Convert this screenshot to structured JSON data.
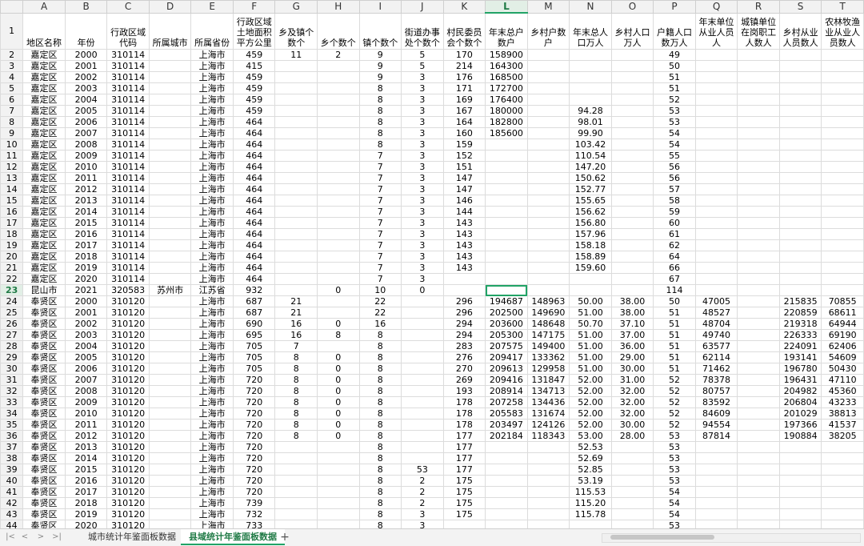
{
  "columns": [
    "A",
    "B",
    "C",
    "D",
    "E",
    "F",
    "G",
    "H",
    "I",
    "J",
    "K",
    "L",
    "M",
    "N",
    "O",
    "P",
    "Q",
    "R",
    "S",
    "T"
  ],
  "selected_column": "L",
  "selected_row": "23",
  "headers": [
    "地区名称",
    "年份",
    "行政区域代码",
    "所属城市",
    "所属省份",
    "行政区域土地面积平方公里",
    "乡及镇个数个",
    "乡个数个",
    "镇个数个",
    "街道办事处个数个",
    "村民委员会个数个",
    "年末总户数户",
    "乡村户数户",
    "年末总人口万人",
    "乡村人口万人",
    "户籍人口数万人",
    "年末单位从业人员人",
    "城镇单位在岗职工人数人",
    "乡村从业人员数人",
    "农林牧渔业从业人员数人"
  ],
  "rows": [
    {
      "n": "2",
      "c": [
        "嘉定区",
        "2000",
        "310114",
        "",
        "上海市",
        "459",
        "11",
        "2",
        "9",
        "5",
        "170",
        "158900",
        "",
        "",
        "",
        "49",
        "",
        "",
        "",
        ""
      ]
    },
    {
      "n": "3",
      "c": [
        "嘉定区",
        "2001",
        "310114",
        "",
        "上海市",
        "415",
        "",
        "",
        "9",
        "5",
        "214",
        "164300",
        "",
        "",
        "",
        "50",
        "",
        "",
        "",
        ""
      ]
    },
    {
      "n": "4",
      "c": [
        "嘉定区",
        "2002",
        "310114",
        "",
        "上海市",
        "459",
        "",
        "",
        "9",
        "3",
        "176",
        "168500",
        "",
        "",
        "",
        "51",
        "",
        "",
        "",
        ""
      ]
    },
    {
      "n": "5",
      "c": [
        "嘉定区",
        "2003",
        "310114",
        "",
        "上海市",
        "459",
        "",
        "",
        "8",
        "3",
        "171",
        "172700",
        "",
        "",
        "",
        "51",
        "",
        "",
        "",
        ""
      ]
    },
    {
      "n": "6",
      "c": [
        "嘉定区",
        "2004",
        "310114",
        "",
        "上海市",
        "459",
        "",
        "",
        "8",
        "3",
        "169",
        "176400",
        "",
        "",
        "",
        "52",
        "",
        "",
        "",
        ""
      ]
    },
    {
      "n": "7",
      "c": [
        "嘉定区",
        "2005",
        "310114",
        "",
        "上海市",
        "459",
        "",
        "",
        "8",
        "3",
        "167",
        "180000",
        "",
        "94.28",
        "",
        "53",
        "",
        "",
        "",
        ""
      ]
    },
    {
      "n": "8",
      "c": [
        "嘉定区",
        "2006",
        "310114",
        "",
        "上海市",
        "464",
        "",
        "",
        "8",
        "3",
        "164",
        "182800",
        "",
        "98.01",
        "",
        "53",
        "",
        "",
        "",
        ""
      ]
    },
    {
      "n": "9",
      "c": [
        "嘉定区",
        "2007",
        "310114",
        "",
        "上海市",
        "464",
        "",
        "",
        "8",
        "3",
        "160",
        "185600",
        "",
        "99.90",
        "",
        "54",
        "",
        "",
        "",
        ""
      ]
    },
    {
      "n": "10",
      "c": [
        "嘉定区",
        "2008",
        "310114",
        "",
        "上海市",
        "464",
        "",
        "",
        "8",
        "3",
        "159",
        "",
        "",
        "103.42",
        "",
        "54",
        "",
        "",
        "",
        ""
      ]
    },
    {
      "n": "11",
      "c": [
        "嘉定区",
        "2009",
        "310114",
        "",
        "上海市",
        "464",
        "",
        "",
        "7",
        "3",
        "152",
        "",
        "",
        "110.54",
        "",
        "55",
        "",
        "",
        "",
        ""
      ]
    },
    {
      "n": "12",
      "c": [
        "嘉定区",
        "2010",
        "310114",
        "",
        "上海市",
        "464",
        "",
        "",
        "7",
        "3",
        "151",
        "",
        "",
        "147.20",
        "",
        "56",
        "",
        "",
        "",
        ""
      ]
    },
    {
      "n": "13",
      "c": [
        "嘉定区",
        "2011",
        "310114",
        "",
        "上海市",
        "464",
        "",
        "",
        "7",
        "3",
        "147",
        "",
        "",
        "150.62",
        "",
        "56",
        "",
        "",
        "",
        ""
      ]
    },
    {
      "n": "14",
      "c": [
        "嘉定区",
        "2012",
        "310114",
        "",
        "上海市",
        "464",
        "",
        "",
        "7",
        "3",
        "147",
        "",
        "",
        "152.77",
        "",
        "57",
        "",
        "",
        "",
        ""
      ]
    },
    {
      "n": "15",
      "c": [
        "嘉定区",
        "2013",
        "310114",
        "",
        "上海市",
        "464",
        "",
        "",
        "7",
        "3",
        "146",
        "",
        "",
        "155.65",
        "",
        "58",
        "",
        "",
        "",
        ""
      ]
    },
    {
      "n": "16",
      "c": [
        "嘉定区",
        "2014",
        "310114",
        "",
        "上海市",
        "464",
        "",
        "",
        "7",
        "3",
        "144",
        "",
        "",
        "156.62",
        "",
        "59",
        "",
        "",
        "",
        ""
      ]
    },
    {
      "n": "17",
      "c": [
        "嘉定区",
        "2015",
        "310114",
        "",
        "上海市",
        "464",
        "",
        "",
        "7",
        "3",
        "143",
        "",
        "",
        "156.80",
        "",
        "60",
        "",
        "",
        "",
        ""
      ]
    },
    {
      "n": "18",
      "c": [
        "嘉定区",
        "2016",
        "310114",
        "",
        "上海市",
        "464",
        "",
        "",
        "7",
        "3",
        "143",
        "",
        "",
        "157.96",
        "",
        "61",
        "",
        "",
        "",
        ""
      ]
    },
    {
      "n": "19",
      "c": [
        "嘉定区",
        "2017",
        "310114",
        "",
        "上海市",
        "464",
        "",
        "",
        "7",
        "3",
        "143",
        "",
        "",
        "158.18",
        "",
        "62",
        "",
        "",
        "",
        ""
      ]
    },
    {
      "n": "20",
      "c": [
        "嘉定区",
        "2018",
        "310114",
        "",
        "上海市",
        "464",
        "",
        "",
        "7",
        "3",
        "143",
        "",
        "",
        "158.89",
        "",
        "64",
        "",
        "",
        "",
        ""
      ]
    },
    {
      "n": "21",
      "c": [
        "嘉定区",
        "2019",
        "310114",
        "",
        "上海市",
        "464",
        "",
        "",
        "7",
        "3",
        "143",
        "",
        "",
        "159.60",
        "",
        "66",
        "",
        "",
        "",
        ""
      ]
    },
    {
      "n": "22",
      "c": [
        "嘉定区",
        "2020",
        "310114",
        "",
        "上海市",
        "464",
        "",
        "",
        "7",
        "3",
        "",
        "",
        "",
        "",
        "",
        "67",
        "",
        "",
        "",
        ""
      ]
    },
    {
      "n": "23",
      "c": [
        "昆山市",
        "2021",
        "320583",
        "苏州市",
        "江苏省",
        "932",
        "",
        "0",
        "10",
        "0",
        "",
        "",
        "",
        "",
        "",
        "114",
        "",
        "",
        "",
        ""
      ]
    },
    {
      "n": "24",
      "c": [
        "奉贤区",
        "2000",
        "310120",
        "",
        "上海市",
        "687",
        "21",
        "",
        "22",
        "",
        "296",
        "194687",
        "148963",
        "50.00",
        "38.00",
        "50",
        "47005",
        "",
        "215835",
        "70855"
      ]
    },
    {
      "n": "25",
      "c": [
        "奉贤区",
        "2001",
        "310120",
        "",
        "上海市",
        "687",
        "21",
        "",
        "22",
        "",
        "296",
        "202500",
        "149690",
        "51.00",
        "38.00",
        "51",
        "48527",
        "",
        "220859",
        "68611"
      ]
    },
    {
      "n": "26",
      "c": [
        "奉贤区",
        "2002",
        "310120",
        "",
        "上海市",
        "690",
        "16",
        "0",
        "16",
        "",
        "294",
        "203600",
        "148648",
        "50.70",
        "37.10",
        "51",
        "48704",
        "",
        "219318",
        "64944"
      ]
    },
    {
      "n": "27",
      "c": [
        "奉贤区",
        "2003",
        "310120",
        "",
        "上海市",
        "695",
        "16",
        "8",
        "8",
        "",
        "294",
        "205300",
        "147175",
        "51.00",
        "37.00",
        "51",
        "49740",
        "",
        "226333",
        "69190"
      ]
    },
    {
      "n": "28",
      "c": [
        "奉贤区",
        "2004",
        "310120",
        "",
        "上海市",
        "705",
        "7",
        "",
        "8",
        "",
        "283",
        "207575",
        "149400",
        "51.00",
        "36.00",
        "51",
        "63577",
        "",
        "224091",
        "62406"
      ]
    },
    {
      "n": "29",
      "c": [
        "奉贤区",
        "2005",
        "310120",
        "",
        "上海市",
        "705",
        "8",
        "0",
        "8",
        "",
        "276",
        "209417",
        "133362",
        "51.00",
        "29.00",
        "51",
        "62114",
        "",
        "193141",
        "54609"
      ]
    },
    {
      "n": "30",
      "c": [
        "奉贤区",
        "2006",
        "310120",
        "",
        "上海市",
        "705",
        "8",
        "0",
        "8",
        "",
        "270",
        "209613",
        "129958",
        "51.00",
        "30.00",
        "51",
        "71462",
        "",
        "196780",
        "50430"
      ]
    },
    {
      "n": "31",
      "c": [
        "奉贤区",
        "2007",
        "310120",
        "",
        "上海市",
        "720",
        "8",
        "0",
        "8",
        "",
        "269",
        "209416",
        "131847",
        "52.00",
        "31.00",
        "52",
        "78378",
        "",
        "196431",
        "47110"
      ]
    },
    {
      "n": "32",
      "c": [
        "奉贤区",
        "2008",
        "310120",
        "",
        "上海市",
        "720",
        "8",
        "0",
        "8",
        "",
        "193",
        "208914",
        "134713",
        "52.00",
        "32.00",
        "52",
        "80757",
        "",
        "204982",
        "45360"
      ]
    },
    {
      "n": "33",
      "c": [
        "奉贤区",
        "2009",
        "310120",
        "",
        "上海市",
        "720",
        "8",
        "0",
        "8",
        "",
        "178",
        "207258",
        "134436",
        "52.00",
        "32.00",
        "52",
        "83592",
        "",
        "206804",
        "43233"
      ]
    },
    {
      "n": "34",
      "c": [
        "奉贤区",
        "2010",
        "310120",
        "",
        "上海市",
        "720",
        "8",
        "0",
        "8",
        "",
        "178",
        "205583",
        "131674",
        "52.00",
        "32.00",
        "52",
        "84609",
        "",
        "201029",
        "38813"
      ]
    },
    {
      "n": "35",
      "c": [
        "奉贤区",
        "2011",
        "310120",
        "",
        "上海市",
        "720",
        "8",
        "0",
        "8",
        "",
        "178",
        "203497",
        "124126",
        "52.00",
        "30.00",
        "52",
        "94554",
        "",
        "197366",
        "41537"
      ]
    },
    {
      "n": "36",
      "c": [
        "奉贤区",
        "2012",
        "310120",
        "",
        "上海市",
        "720",
        "8",
        "0",
        "8",
        "",
        "177",
        "202184",
        "118343",
        "53.00",
        "28.00",
        "53",
        "87814",
        "",
        "190884",
        "38205"
      ]
    },
    {
      "n": "37",
      "c": [
        "奉贤区",
        "2013",
        "310120",
        "",
        "上海市",
        "720",
        "",
        "",
        "8",
        "",
        "177",
        "",
        "",
        "52.53",
        "",
        "53",
        "",
        "",
        "",
        ""
      ]
    },
    {
      "n": "38",
      "c": [
        "奉贤区",
        "2014",
        "310120",
        "",
        "上海市",
        "720",
        "",
        "",
        "8",
        "",
        "177",
        "",
        "",
        "52.69",
        "",
        "53",
        "",
        "",
        "",
        ""
      ]
    },
    {
      "n": "39",
      "c": [
        "奉贤区",
        "2015",
        "310120",
        "",
        "上海市",
        "720",
        "",
        "",
        "8",
        "53",
        "177",
        "",
        "",
        "52.85",
        "",
        "53",
        "",
        "",
        "",
        ""
      ]
    },
    {
      "n": "40",
      "c": [
        "奉贤区",
        "2016",
        "310120",
        "",
        "上海市",
        "720",
        "",
        "",
        "8",
        "2",
        "175",
        "",
        "",
        "53.19",
        "",
        "53",
        "",
        "",
        "",
        ""
      ]
    },
    {
      "n": "41",
      "c": [
        "奉贤区",
        "2017",
        "310120",
        "",
        "上海市",
        "720",
        "",
        "",
        "8",
        "2",
        "175",
        "",
        "",
        "115.53",
        "",
        "54",
        "",
        "",
        "",
        ""
      ]
    },
    {
      "n": "42",
      "c": [
        "奉贤区",
        "2018",
        "310120",
        "",
        "上海市",
        "739",
        "",
        "",
        "8",
        "2",
        "175",
        "",
        "",
        "115.20",
        "",
        "54",
        "",
        "",
        "",
        ""
      ]
    },
    {
      "n": "43",
      "c": [
        "奉贤区",
        "2019",
        "310120",
        "",
        "上海市",
        "732",
        "",
        "",
        "8",
        "3",
        "175",
        "",
        "",
        "115.78",
        "",
        "54",
        "",
        "",
        "",
        ""
      ]
    },
    {
      "n": "44",
      "c": [
        "奉贤区",
        "2020",
        "310120",
        "",
        "上海市",
        "733",
        "",
        "",
        "8",
        "3",
        "",
        "",
        "",
        "",
        "",
        "53",
        "",
        "",
        "",
        ""
      ]
    }
  ],
  "tabs": [
    {
      "label": "城市统计年鉴面板数据",
      "active": false
    },
    {
      "label": "县域统计年鉴面板数据",
      "active": true
    }
  ],
  "add_tab_label": "+",
  "nav": {
    "first": "|<",
    "prev": "<",
    "next": ">",
    "last": ">|"
  }
}
